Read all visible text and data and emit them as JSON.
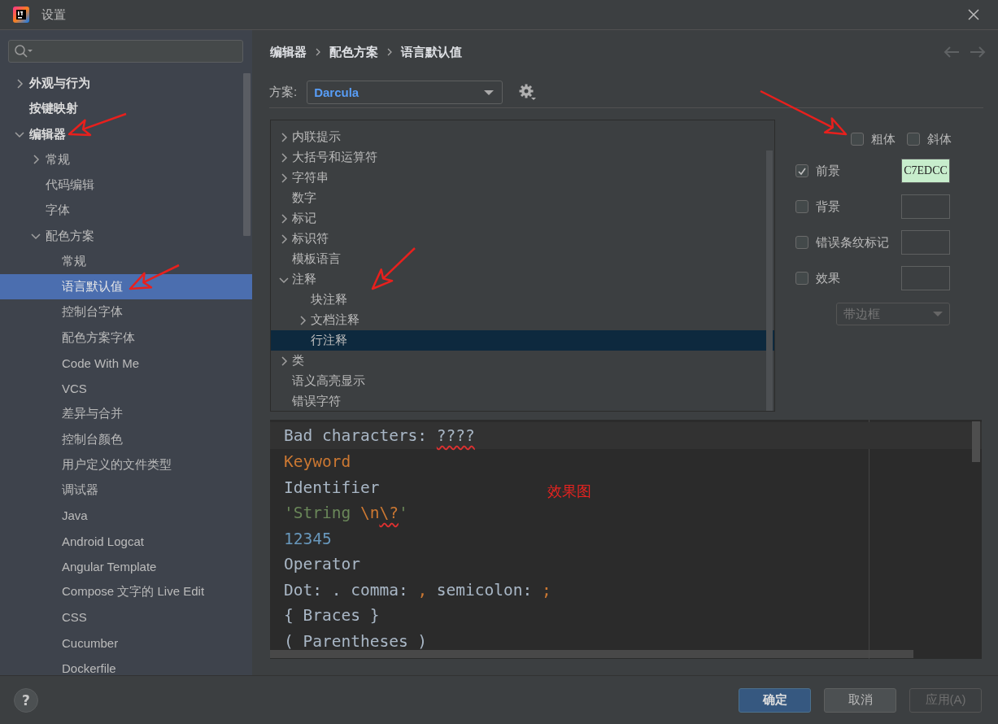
{
  "window": {
    "title": "设置"
  },
  "sidebar": {
    "tree": [
      {
        "label": "外观与行为",
        "kind": "group",
        "expanded": false,
        "selected": false
      },
      {
        "label": "按键映射",
        "kind": "leaf",
        "selected": false
      },
      {
        "label": "编辑器",
        "kind": "group",
        "expanded": true,
        "selected": false,
        "children": [
          {
            "label": "常规",
            "kind": "group",
            "expanded": false,
            "selected": false
          },
          {
            "label": "代码编辑",
            "kind": "leaf",
            "selected": false
          },
          {
            "label": "字体",
            "kind": "leaf",
            "selected": false
          },
          {
            "label": "配色方案",
            "kind": "group",
            "expanded": true,
            "selected": false,
            "children": [
              {
                "label": "常规",
                "kind": "leaf",
                "selected": false
              },
              {
                "label": "语言默认值",
                "kind": "leaf",
                "selected": true
              },
              {
                "label": "控制台字体",
                "kind": "leaf",
                "selected": false
              },
              {
                "label": "配色方案字体",
                "kind": "leaf",
                "selected": false
              },
              {
                "label": "Code With Me",
                "kind": "leaf",
                "selected": false
              },
              {
                "label": "VCS",
                "kind": "leaf",
                "selected": false
              },
              {
                "label": "差异与合并",
                "kind": "leaf",
                "selected": false
              },
              {
                "label": "控制台颜色",
                "kind": "leaf",
                "selected": false
              },
              {
                "label": "用户定义的文件类型",
                "kind": "leaf",
                "selected": false
              },
              {
                "label": "调试器",
                "kind": "leaf",
                "selected": false
              },
              {
                "label": "Java",
                "kind": "leaf",
                "selected": false
              },
              {
                "label": "Android Logcat",
                "kind": "leaf",
                "selected": false
              },
              {
                "label": "Angular Template",
                "kind": "leaf",
                "selected": false
              },
              {
                "label": "Compose 文字的 Live Edit",
                "kind": "leaf",
                "selected": false
              },
              {
                "label": "CSS",
                "kind": "leaf",
                "selected": false
              },
              {
                "label": "Cucumber",
                "kind": "leaf",
                "selected": false
              },
              {
                "label": "Dockerfile",
                "kind": "leaf",
                "selected": false
              }
            ]
          }
        ]
      }
    ]
  },
  "breadcrumb": [
    "编辑器",
    "配色方案",
    "语言默认值"
  ],
  "scheme": {
    "label": "方案:",
    "value": "Darcula"
  },
  "attributes_tree": [
    {
      "label": "内联提示",
      "kind": "group",
      "expanded": false,
      "selected": false
    },
    {
      "label": "大括号和运算符",
      "kind": "group",
      "expanded": false,
      "selected": false
    },
    {
      "label": "字符串",
      "kind": "group",
      "expanded": false,
      "selected": false
    },
    {
      "label": "数字",
      "kind": "leaf",
      "selected": false
    },
    {
      "label": "标记",
      "kind": "group",
      "expanded": false,
      "selected": false
    },
    {
      "label": "标识符",
      "kind": "group",
      "expanded": false,
      "selected": false
    },
    {
      "label": "模板语言",
      "kind": "leaf",
      "selected": false
    },
    {
      "label": "注释",
      "kind": "group",
      "expanded": true,
      "selected": false,
      "children": [
        {
          "label": "块注释",
          "kind": "leaf",
          "selected": false
        },
        {
          "label": "文档注释",
          "kind": "group",
          "expanded": false,
          "selected": false
        },
        {
          "label": "行注释",
          "kind": "leaf",
          "selected": true
        }
      ]
    },
    {
      "label": "类",
      "kind": "group",
      "expanded": false,
      "selected": false
    },
    {
      "label": "语义高亮显示",
      "kind": "leaf",
      "selected": false
    },
    {
      "label": "错误字符",
      "kind": "leaf",
      "selected": false
    }
  ],
  "font_styles": [
    {
      "label": "粗体",
      "checked": false
    },
    {
      "label": "斜体",
      "checked": false
    }
  ],
  "attributes": [
    {
      "label": "前景",
      "checked": true,
      "swatch": {
        "value": "C7EDCC",
        "color": "#c7edcc"
      }
    },
    {
      "label": "背景",
      "checked": false
    },
    {
      "label": "错误条纹标记",
      "checked": false
    },
    {
      "label": "效果",
      "checked": false
    }
  ],
  "effect_style": {
    "value": "带边框",
    "disabled": true
  },
  "preview": {
    "annotation": "效果图",
    "lines": [
      {
        "current": true,
        "tokens": [
          {
            "text": "Bad characters: ",
            "kind": "plain"
          },
          {
            "text": "????",
            "kind": "bad_char"
          }
        ]
      },
      {
        "current": false,
        "tokens": [
          {
            "text": "Keyword",
            "kind": "keyword"
          }
        ]
      },
      {
        "current": false,
        "tokens": [
          {
            "text": "Identifier",
            "kind": "plain"
          }
        ]
      },
      {
        "current": false,
        "tokens": [
          {
            "text": "'String ",
            "kind": "string"
          },
          {
            "text": "\\n",
            "kind": "escape"
          },
          {
            "text": "\\?",
            "kind": "bad_escape"
          },
          {
            "text": "'",
            "kind": "string"
          }
        ]
      },
      {
        "current": false,
        "tokens": [
          {
            "text": "12345",
            "kind": "number"
          }
        ]
      },
      {
        "current": false,
        "tokens": [
          {
            "text": "Operator",
            "kind": "plain"
          }
        ]
      },
      {
        "current": false,
        "tokens": [
          {
            "text": "Dot: . comma: ",
            "kind": "plain"
          },
          {
            "text": ",",
            "kind": "keyword"
          },
          {
            "text": " semicolon: ",
            "kind": "plain"
          },
          {
            "text": ";",
            "kind": "keyword"
          }
        ]
      },
      {
        "current": false,
        "tokens": [
          {
            "text": "{ Braces }",
            "kind": "plain"
          }
        ]
      },
      {
        "current": false,
        "tokens": [
          {
            "text": "( Parentheses )",
            "kind": "plain"
          }
        ]
      }
    ]
  },
  "help": "?",
  "buttons": [
    {
      "label": "确定",
      "kind": "primary",
      "disabled": false
    },
    {
      "label": "取消",
      "kind": "normal",
      "disabled": false
    },
    {
      "label": "应用(A)",
      "kind": "normal",
      "disabled": true
    }
  ]
}
